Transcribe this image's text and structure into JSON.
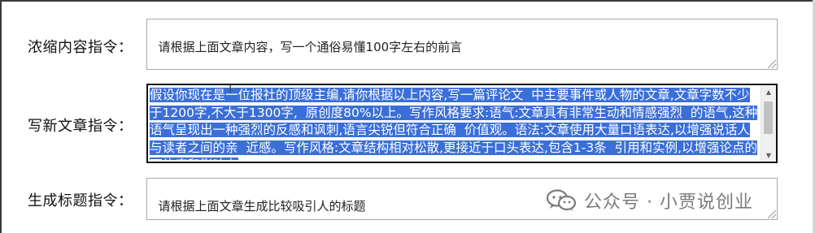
{
  "rows": [
    {
      "label": "浓缩内容指令：",
      "value": "请根据上面文章内容，写一个通俗易懂100字左右的前言"
    },
    {
      "label": "写新文章指令：",
      "value": "假设你现在是一位报社的顶级主编,请你根据以上内容,写一篇评论文  中主要事件或人物的文章,文章字数不少于1200字,不大于1300字,  原创度80%以上。写作风格要求:语气:文章具有非常生动和情感强烈  的语气,这种语气呈现出一种强烈的反感和讽刺,语言尖锐但符合正确  价值观。语法:文章使用大量口语表达,以增强说话人与读者之间的亲  近感。写作风格:文章结构相对松散,更接近于口头表达,包含1-3条  引用和实例,以增强论点的可信度和影响力"
    },
    {
      "label": "生成标题指令：",
      "value": "请根据上面文章生成比较吸引人的标题"
    }
  ],
  "watermark": {
    "text": "公众号 · 小贾说创业",
    "icon": "wechat-icon",
    "color": "#7b7b7b"
  },
  "colors": {
    "selection": "#3b6fd8",
    "focus_border": "#111111"
  }
}
